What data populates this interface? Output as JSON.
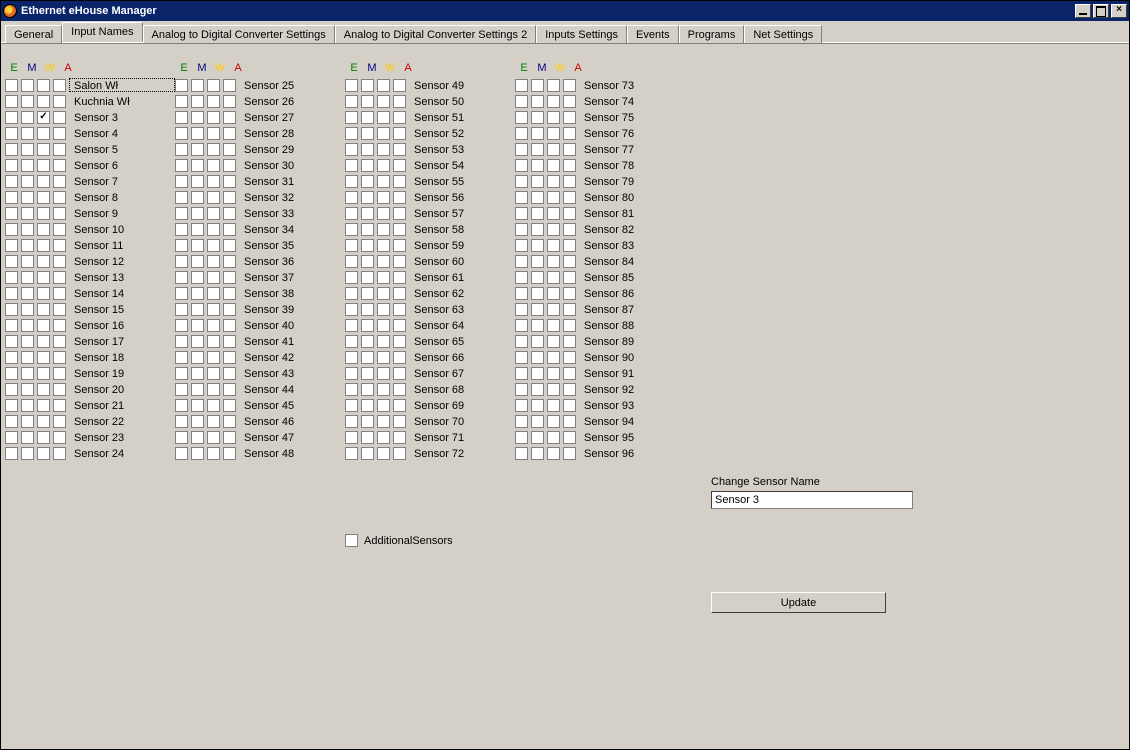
{
  "window": {
    "title": "Ethernet eHouse Manager"
  },
  "tabs": [
    {
      "label": "General",
      "active": false
    },
    {
      "label": "Input Names",
      "active": true
    },
    {
      "label": "Analog to Digital Converter Settings",
      "active": false
    },
    {
      "label": "Analog to Digital Converter Settings 2",
      "active": false
    },
    {
      "label": "Inputs Settings",
      "active": false
    },
    {
      "label": "Events",
      "active": false
    },
    {
      "label": "Programs",
      "active": false
    },
    {
      "label": "Net Settings",
      "active": false
    }
  ],
  "columnHeader": {
    "E": "E",
    "M": "M",
    "W": "W",
    "A": "A"
  },
  "additional": {
    "label": "AdditionalSensors",
    "checked": false
  },
  "change": {
    "label": "Change Sensor Name",
    "value": "Sensor 3"
  },
  "updateLabel": "Update",
  "selectedIndex": 0,
  "sensors": [
    {
      "name": "Salon Wł",
      "e": false,
      "m": false,
      "w": false,
      "a": false
    },
    {
      "name": "Kuchnia Wł",
      "e": false,
      "m": false,
      "w": false,
      "a": false
    },
    {
      "name": "Sensor 3",
      "e": false,
      "m": false,
      "w": true,
      "a": false
    },
    {
      "name": "Sensor 4",
      "e": false,
      "m": false,
      "w": false,
      "a": false
    },
    {
      "name": "Sensor 5",
      "e": false,
      "m": false,
      "w": false,
      "a": false
    },
    {
      "name": "Sensor 6",
      "e": false,
      "m": false,
      "w": false,
      "a": false
    },
    {
      "name": "Sensor 7",
      "e": false,
      "m": false,
      "w": false,
      "a": false
    },
    {
      "name": "Sensor 8",
      "e": false,
      "m": false,
      "w": false,
      "a": false
    },
    {
      "name": "Sensor 9",
      "e": false,
      "m": false,
      "w": false,
      "a": false
    },
    {
      "name": "Sensor 10",
      "e": false,
      "m": false,
      "w": false,
      "a": false
    },
    {
      "name": "Sensor 11",
      "e": false,
      "m": false,
      "w": false,
      "a": false
    },
    {
      "name": "Sensor 12",
      "e": false,
      "m": false,
      "w": false,
      "a": false
    },
    {
      "name": "Sensor 13",
      "e": false,
      "m": false,
      "w": false,
      "a": false
    },
    {
      "name": "Sensor 14",
      "e": false,
      "m": false,
      "w": false,
      "a": false
    },
    {
      "name": "Sensor 15",
      "e": false,
      "m": false,
      "w": false,
      "a": false
    },
    {
      "name": "Sensor 16",
      "e": false,
      "m": false,
      "w": false,
      "a": false
    },
    {
      "name": "Sensor 17",
      "e": false,
      "m": false,
      "w": false,
      "a": false
    },
    {
      "name": "Sensor 18",
      "e": false,
      "m": false,
      "w": false,
      "a": false
    },
    {
      "name": "Sensor 19",
      "e": false,
      "m": false,
      "w": false,
      "a": false
    },
    {
      "name": "Sensor 20",
      "e": false,
      "m": false,
      "w": false,
      "a": false
    },
    {
      "name": "Sensor 21",
      "e": false,
      "m": false,
      "w": false,
      "a": false
    },
    {
      "name": "Sensor 22",
      "e": false,
      "m": false,
      "w": false,
      "a": false
    },
    {
      "name": "Sensor 23",
      "e": false,
      "m": false,
      "w": false,
      "a": false
    },
    {
      "name": "Sensor 24",
      "e": false,
      "m": false,
      "w": false,
      "a": false
    },
    {
      "name": "Sensor 25",
      "e": false,
      "m": false,
      "w": false,
      "a": false
    },
    {
      "name": "Sensor 26",
      "e": false,
      "m": false,
      "w": false,
      "a": false
    },
    {
      "name": "Sensor 27",
      "e": false,
      "m": false,
      "w": false,
      "a": false
    },
    {
      "name": "Sensor 28",
      "e": false,
      "m": false,
      "w": false,
      "a": false
    },
    {
      "name": "Sensor 29",
      "e": false,
      "m": false,
      "w": false,
      "a": false
    },
    {
      "name": "Sensor 30",
      "e": false,
      "m": false,
      "w": false,
      "a": false
    },
    {
      "name": "Sensor 31",
      "e": false,
      "m": false,
      "w": false,
      "a": false
    },
    {
      "name": "Sensor 32",
      "e": false,
      "m": false,
      "w": false,
      "a": false
    },
    {
      "name": "Sensor 33",
      "e": false,
      "m": false,
      "w": false,
      "a": false
    },
    {
      "name": "Sensor 34",
      "e": false,
      "m": false,
      "w": false,
      "a": false
    },
    {
      "name": "Sensor 35",
      "e": false,
      "m": false,
      "w": false,
      "a": false
    },
    {
      "name": "Sensor 36",
      "e": false,
      "m": false,
      "w": false,
      "a": false
    },
    {
      "name": "Sensor 37",
      "e": false,
      "m": false,
      "w": false,
      "a": false
    },
    {
      "name": "Sensor 38",
      "e": false,
      "m": false,
      "w": false,
      "a": false
    },
    {
      "name": "Sensor 39",
      "e": false,
      "m": false,
      "w": false,
      "a": false
    },
    {
      "name": "Sensor 40",
      "e": false,
      "m": false,
      "w": false,
      "a": false
    },
    {
      "name": "Sensor 41",
      "e": false,
      "m": false,
      "w": false,
      "a": false
    },
    {
      "name": "Sensor 42",
      "e": false,
      "m": false,
      "w": false,
      "a": false
    },
    {
      "name": "Sensor 43",
      "e": false,
      "m": false,
      "w": false,
      "a": false
    },
    {
      "name": "Sensor 44",
      "e": false,
      "m": false,
      "w": false,
      "a": false
    },
    {
      "name": "Sensor 45",
      "e": false,
      "m": false,
      "w": false,
      "a": false
    },
    {
      "name": "Sensor 46",
      "e": false,
      "m": false,
      "w": false,
      "a": false
    },
    {
      "name": "Sensor 47",
      "e": false,
      "m": false,
      "w": false,
      "a": false
    },
    {
      "name": "Sensor 48",
      "e": false,
      "m": false,
      "w": false,
      "a": false
    },
    {
      "name": "Sensor 49",
      "e": false,
      "m": false,
      "w": false,
      "a": false
    },
    {
      "name": "Sensor 50",
      "e": false,
      "m": false,
      "w": false,
      "a": false
    },
    {
      "name": "Sensor 51",
      "e": false,
      "m": false,
      "w": false,
      "a": false
    },
    {
      "name": "Sensor 52",
      "e": false,
      "m": false,
      "w": false,
      "a": false
    },
    {
      "name": "Sensor 53",
      "e": false,
      "m": false,
      "w": false,
      "a": false
    },
    {
      "name": "Sensor 54",
      "e": false,
      "m": false,
      "w": false,
      "a": false
    },
    {
      "name": "Sensor 55",
      "e": false,
      "m": false,
      "w": false,
      "a": false
    },
    {
      "name": "Sensor 56",
      "e": false,
      "m": false,
      "w": false,
      "a": false
    },
    {
      "name": "Sensor 57",
      "e": false,
      "m": false,
      "w": false,
      "a": false
    },
    {
      "name": "Sensor 58",
      "e": false,
      "m": false,
      "w": false,
      "a": false
    },
    {
      "name": "Sensor 59",
      "e": false,
      "m": false,
      "w": false,
      "a": false
    },
    {
      "name": "Sensor 60",
      "e": false,
      "m": false,
      "w": false,
      "a": false
    },
    {
      "name": "Sensor 61",
      "e": false,
      "m": false,
      "w": false,
      "a": false
    },
    {
      "name": "Sensor 62",
      "e": false,
      "m": false,
      "w": false,
      "a": false
    },
    {
      "name": "Sensor 63",
      "e": false,
      "m": false,
      "w": false,
      "a": false
    },
    {
      "name": "Sensor 64",
      "e": false,
      "m": false,
      "w": false,
      "a": false
    },
    {
      "name": "Sensor 65",
      "e": false,
      "m": false,
      "w": false,
      "a": false
    },
    {
      "name": "Sensor 66",
      "e": false,
      "m": false,
      "w": false,
      "a": false
    },
    {
      "name": "Sensor 67",
      "e": false,
      "m": false,
      "w": false,
      "a": false
    },
    {
      "name": "Sensor 68",
      "e": false,
      "m": false,
      "w": false,
      "a": false
    },
    {
      "name": "Sensor 69",
      "e": false,
      "m": false,
      "w": false,
      "a": false
    },
    {
      "name": "Sensor 70",
      "e": false,
      "m": false,
      "w": false,
      "a": false
    },
    {
      "name": "Sensor 71",
      "e": false,
      "m": false,
      "w": false,
      "a": false
    },
    {
      "name": "Sensor 72",
      "e": false,
      "m": false,
      "w": false,
      "a": false
    },
    {
      "name": "Sensor 73",
      "e": false,
      "m": false,
      "w": false,
      "a": false
    },
    {
      "name": "Sensor 74",
      "e": false,
      "m": false,
      "w": false,
      "a": false
    },
    {
      "name": "Sensor 75",
      "e": false,
      "m": false,
      "w": false,
      "a": false
    },
    {
      "name": "Sensor 76",
      "e": false,
      "m": false,
      "w": false,
      "a": false
    },
    {
      "name": "Sensor 77",
      "e": false,
      "m": false,
      "w": false,
      "a": false
    },
    {
      "name": "Sensor 78",
      "e": false,
      "m": false,
      "w": false,
      "a": false
    },
    {
      "name": "Sensor 79",
      "e": false,
      "m": false,
      "w": false,
      "a": false
    },
    {
      "name": "Sensor 80",
      "e": false,
      "m": false,
      "w": false,
      "a": false
    },
    {
      "name": "Sensor 81",
      "e": false,
      "m": false,
      "w": false,
      "a": false
    },
    {
      "name": "Sensor 82",
      "e": false,
      "m": false,
      "w": false,
      "a": false
    },
    {
      "name": "Sensor 83",
      "e": false,
      "m": false,
      "w": false,
      "a": false
    },
    {
      "name": "Sensor 84",
      "e": false,
      "m": false,
      "w": false,
      "a": false
    },
    {
      "name": "Sensor 85",
      "e": false,
      "m": false,
      "w": false,
      "a": false
    },
    {
      "name": "Sensor 86",
      "e": false,
      "m": false,
      "w": false,
      "a": false
    },
    {
      "name": "Sensor 87",
      "e": false,
      "m": false,
      "w": false,
      "a": false
    },
    {
      "name": "Sensor 88",
      "e": false,
      "m": false,
      "w": false,
      "a": false
    },
    {
      "name": "Sensor 89",
      "e": false,
      "m": false,
      "w": false,
      "a": false
    },
    {
      "name": "Sensor 90",
      "e": false,
      "m": false,
      "w": false,
      "a": false
    },
    {
      "name": "Sensor 91",
      "e": false,
      "m": false,
      "w": false,
      "a": false
    },
    {
      "name": "Sensor 92",
      "e": false,
      "m": false,
      "w": false,
      "a": false
    },
    {
      "name": "Sensor 93",
      "e": false,
      "m": false,
      "w": false,
      "a": false
    },
    {
      "name": "Sensor 94",
      "e": false,
      "m": false,
      "w": false,
      "a": false
    },
    {
      "name": "Sensor 95",
      "e": false,
      "m": false,
      "w": false,
      "a": false
    },
    {
      "name": "Sensor 96",
      "e": false,
      "m": false,
      "w": false,
      "a": false
    }
  ]
}
